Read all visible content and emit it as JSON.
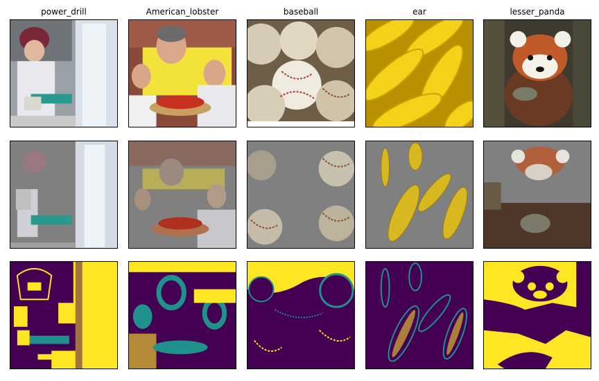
{
  "columns": [
    {
      "title": "power_drill"
    },
    {
      "title": "American_lobster"
    },
    {
      "title": "baseball"
    },
    {
      "title": "ear"
    },
    {
      "title": "lesser_panda"
    }
  ],
  "rows": [
    "original",
    "masked",
    "mask"
  ],
  "colors": {
    "viridis_yellow": "#fde725",
    "viridis_purple": "#440154",
    "viridis_teal": "#21918c",
    "mask_gray": "#808080"
  }
}
